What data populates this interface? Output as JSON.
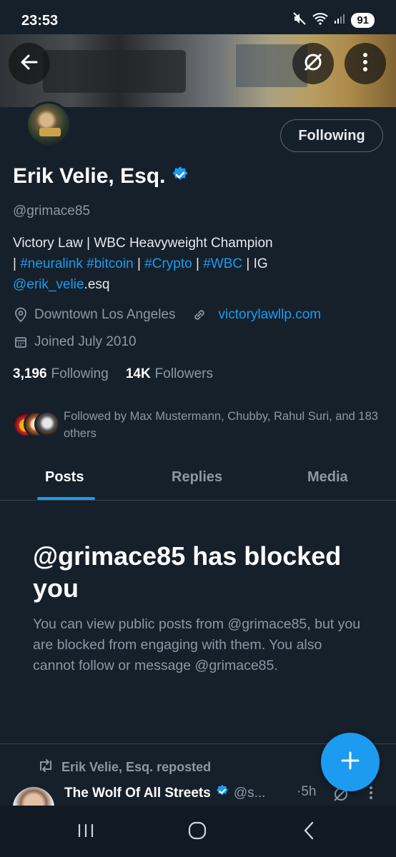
{
  "status_bar": {
    "time": "23:53",
    "battery": "91"
  },
  "header": {
    "back_icon": "arrow-left-icon",
    "grok_icon": "grok-icon",
    "more_icon": "more-vertical-icon"
  },
  "profile": {
    "follow_state_label": "Following",
    "display_name": "Erik Velie, Esq.",
    "handle": "@grimace85",
    "bio": {
      "line1": "Victory Law  | WBC Heavyweight Champion",
      "sep1": "| ",
      "tag_neuralink": "#neuralink",
      "tag_bitcoin": "#bitcoin",
      "sep2": " | ",
      "tag_crypto": "#Crypto",
      "sep3": " | ",
      "tag_wbc": "#WBC",
      "sep4": " | IG",
      "mention": "@erik_velie",
      "mention_suffix": ".esq"
    },
    "location": "Downtown Los Angeles",
    "website": "victorylawllp.com",
    "joined": "Joined July 2010",
    "following_count": "3,196",
    "following_label": "Following",
    "followers_count": "14K",
    "followers_label": "Followers",
    "followed_by": "Followed by Max Mustermann, Chubby, Rahul Suri, and 183 others"
  },
  "tabs": [
    {
      "label": "Posts",
      "active": true
    },
    {
      "label": "Replies",
      "active": false
    },
    {
      "label": "Media",
      "active": false
    }
  ],
  "blocked": {
    "title": "@grimace85 has blocked you",
    "body": "You can view public posts from @grimace85, but you are blocked from engaging with them. You also cannot follow or message @grimace85."
  },
  "post": {
    "repost_label": "Erik Velie, Esq. reposted",
    "author_name": "The Wolf Of All Streets",
    "author_handle": "@s...",
    "time": "·5h"
  },
  "colors": {
    "accent": "#1d9bf0",
    "background": "#15202b",
    "muted": "#8b98a5"
  }
}
